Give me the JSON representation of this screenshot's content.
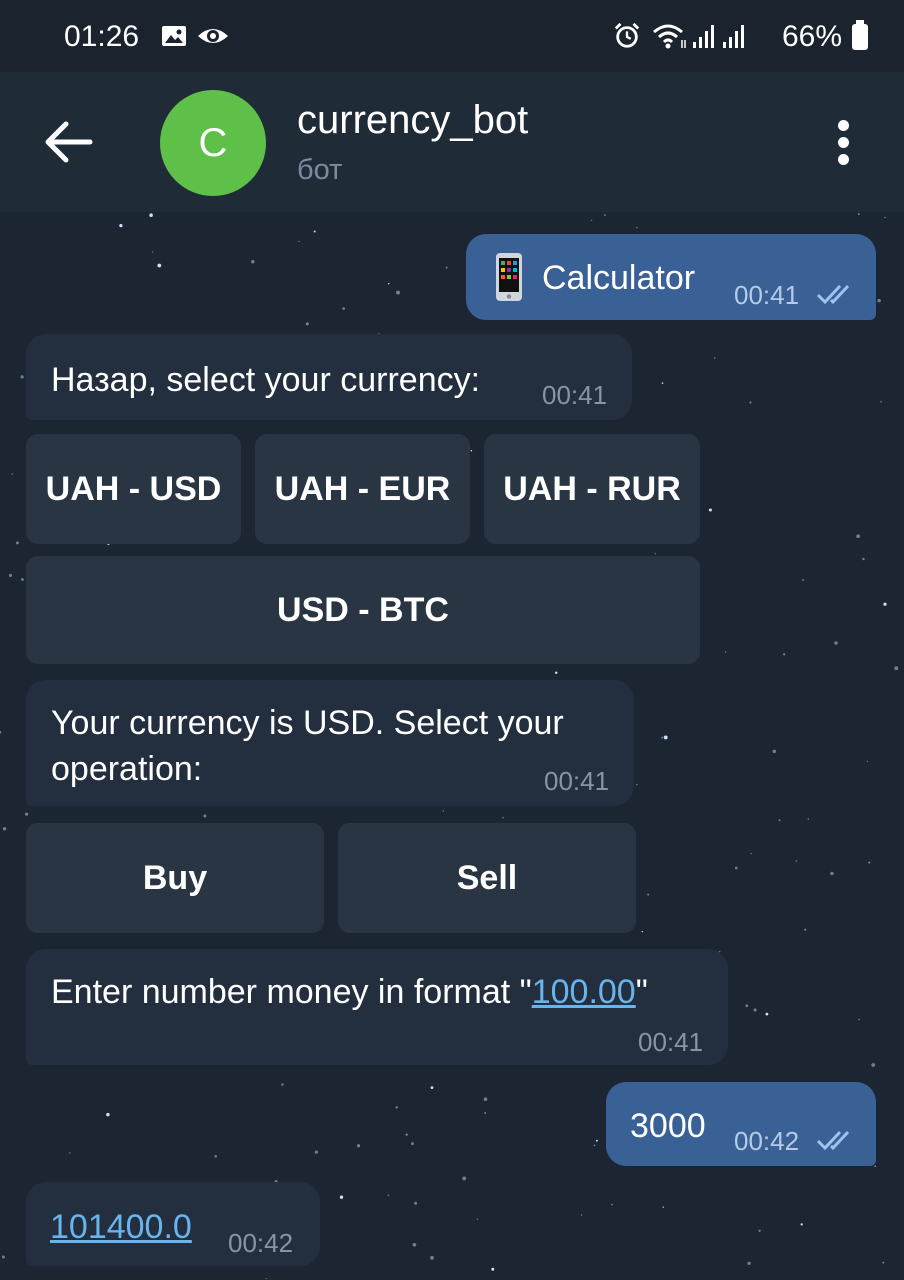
{
  "status_bar": {
    "time": "01:26",
    "battery": "66%",
    "icons": [
      "image-icon",
      "eye-icon",
      "alarm-icon",
      "wifi-icon",
      "signal-icon",
      "signal-icon",
      "battery-icon"
    ]
  },
  "header": {
    "avatar_letter": "C",
    "title": "currency_bot",
    "subtitle": "бот"
  },
  "colors": {
    "outgoing_bubble": "#3a6195",
    "incoming_bubble": "#232f3e",
    "keyboard_button": "#2a3544",
    "avatar": "#5fc049",
    "link": "#6ab4ee"
  },
  "messages": {
    "m1": {
      "text": "Calculator",
      "emoji": "mobile-phone-icon",
      "time": "00:41",
      "direction": "out",
      "status": "read"
    },
    "m2": {
      "text": "Назар, select your currency:",
      "time": "00:41",
      "direction": "in"
    },
    "m3": {
      "line1": "Your currency is USD. Select your",
      "line2": "operation:",
      "time": "00:41",
      "direction": "in"
    },
    "m4": {
      "prefix": "Enter number money in format \"",
      "link": "100.00",
      "suffix": "\"",
      "time": "00:41",
      "direction": "in"
    },
    "m5": {
      "text": "3000",
      "time": "00:42",
      "direction": "out",
      "status": "read"
    },
    "m6": {
      "link": "101400.0",
      "time": "00:42",
      "direction": "in"
    }
  },
  "keyboards": {
    "currency": [
      "UAH - USD",
      "UAH - EUR",
      "UAH - RUR",
      "USD - BTC"
    ],
    "operation": [
      "Buy",
      "Sell"
    ]
  }
}
